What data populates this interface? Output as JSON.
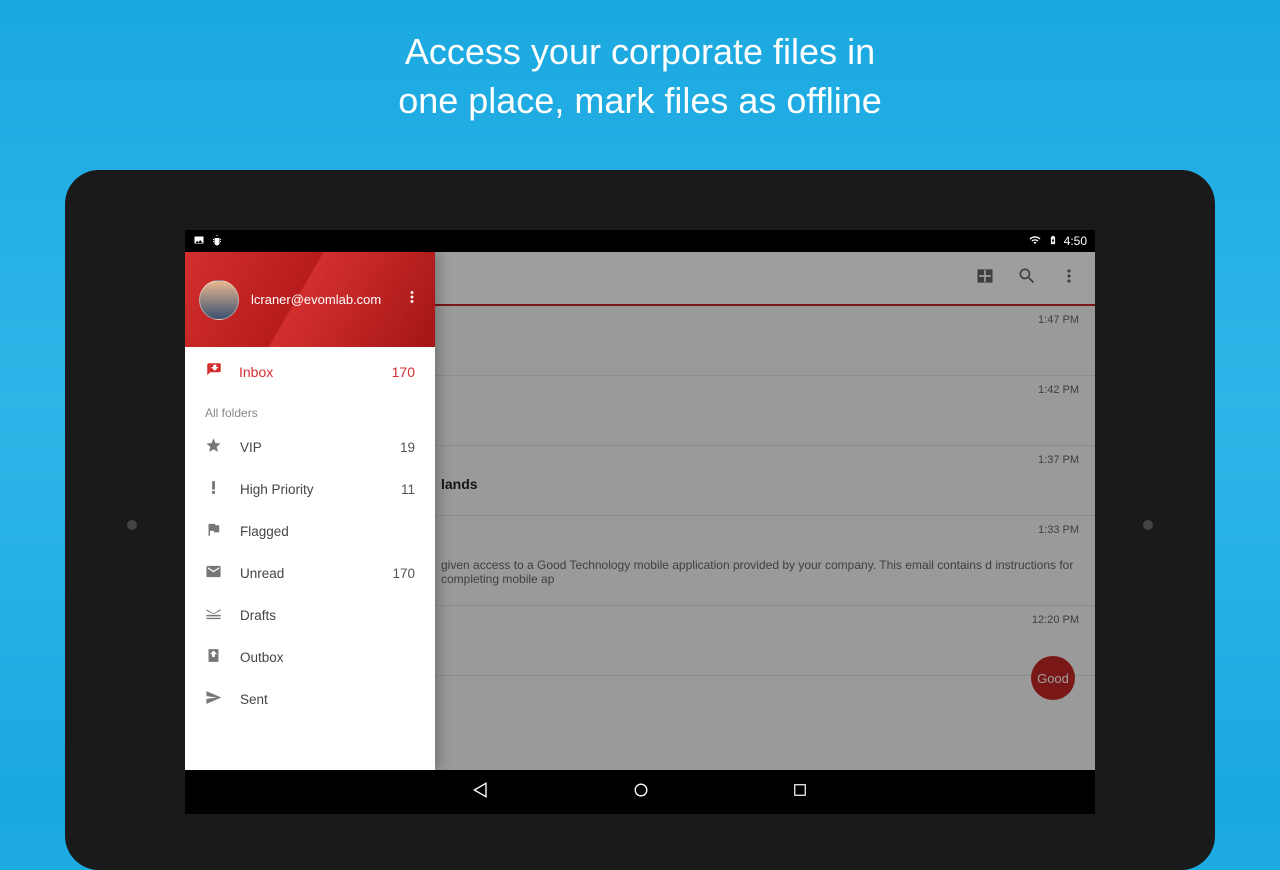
{
  "marketing": {
    "headline_line1": "Access your corporate files in",
    "headline_line2": "one place, mark files as offline"
  },
  "statusbar": {
    "time": "4:50"
  },
  "header": {
    "email": "lcraner@evomlab.com"
  },
  "sidebar": {
    "inbox": {
      "label": "Inbox",
      "count": "170"
    },
    "section_label": "All folders",
    "folders": [
      {
        "label": "VIP",
        "count": "19"
      },
      {
        "label": "High Priority",
        "count": "11"
      },
      {
        "label": "Flagged",
        "count": ""
      },
      {
        "label": "Unread",
        "count": "170"
      },
      {
        "label": "Drafts",
        "count": ""
      },
      {
        "label": "Outbox",
        "count": ""
      },
      {
        "label": "Sent",
        "count": ""
      }
    ]
  },
  "mail": {
    "items": [
      {
        "time": "1:47 PM",
        "subject": "",
        "snippet": ""
      },
      {
        "time": "1:42 PM",
        "subject": "",
        "snippet": ""
      },
      {
        "time": "1:37 PM",
        "subject": "lands",
        "snippet": ""
      },
      {
        "time": "1:33 PM",
        "subject": "",
        "snippet": "given access to a Good Technology mobile application provided by your company. This email contains d instructions for completing mobile ap"
      },
      {
        "time": "12:20 PM",
        "subject": "",
        "snippet": ""
      }
    ],
    "badge": "Good"
  }
}
